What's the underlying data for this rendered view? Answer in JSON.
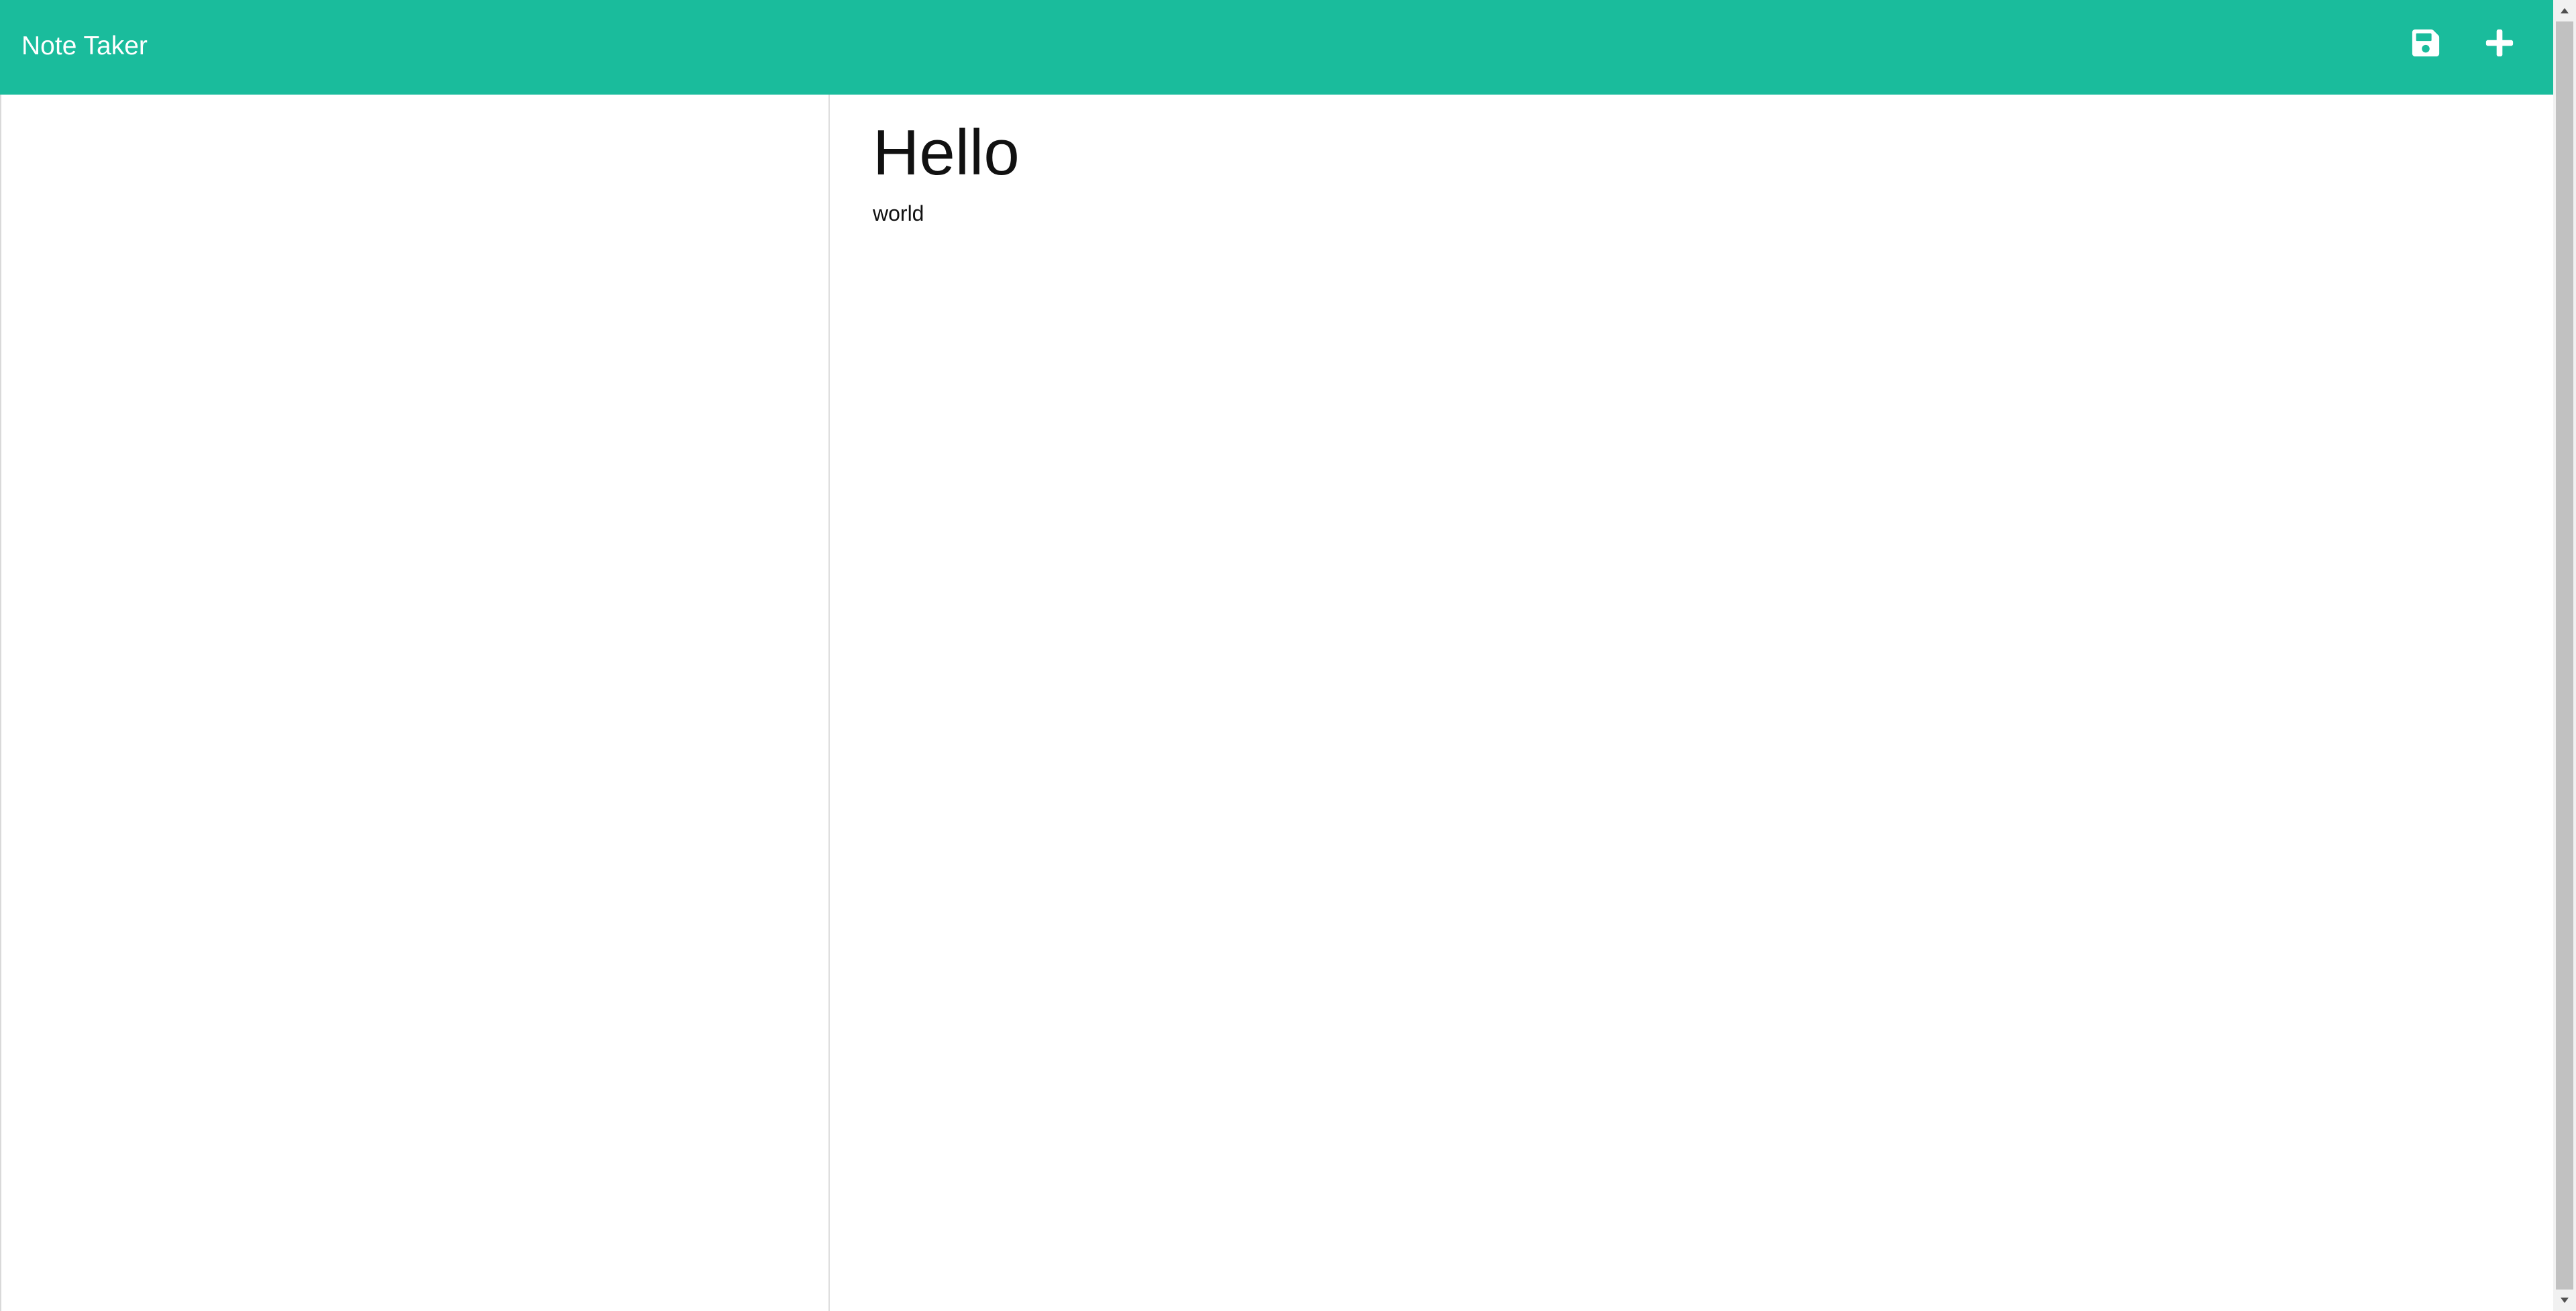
{
  "navbar": {
    "brand": "Note Taker",
    "background_color": "#1abc9c",
    "icons": [
      {
        "name": "save-icon",
        "glyph": "floppy-disk"
      },
      {
        "name": "plus-icon",
        "glyph": "plus"
      }
    ]
  },
  "sidebar": {
    "notes": []
  },
  "editor": {
    "title_value": "Hello",
    "body_value": "world"
  }
}
